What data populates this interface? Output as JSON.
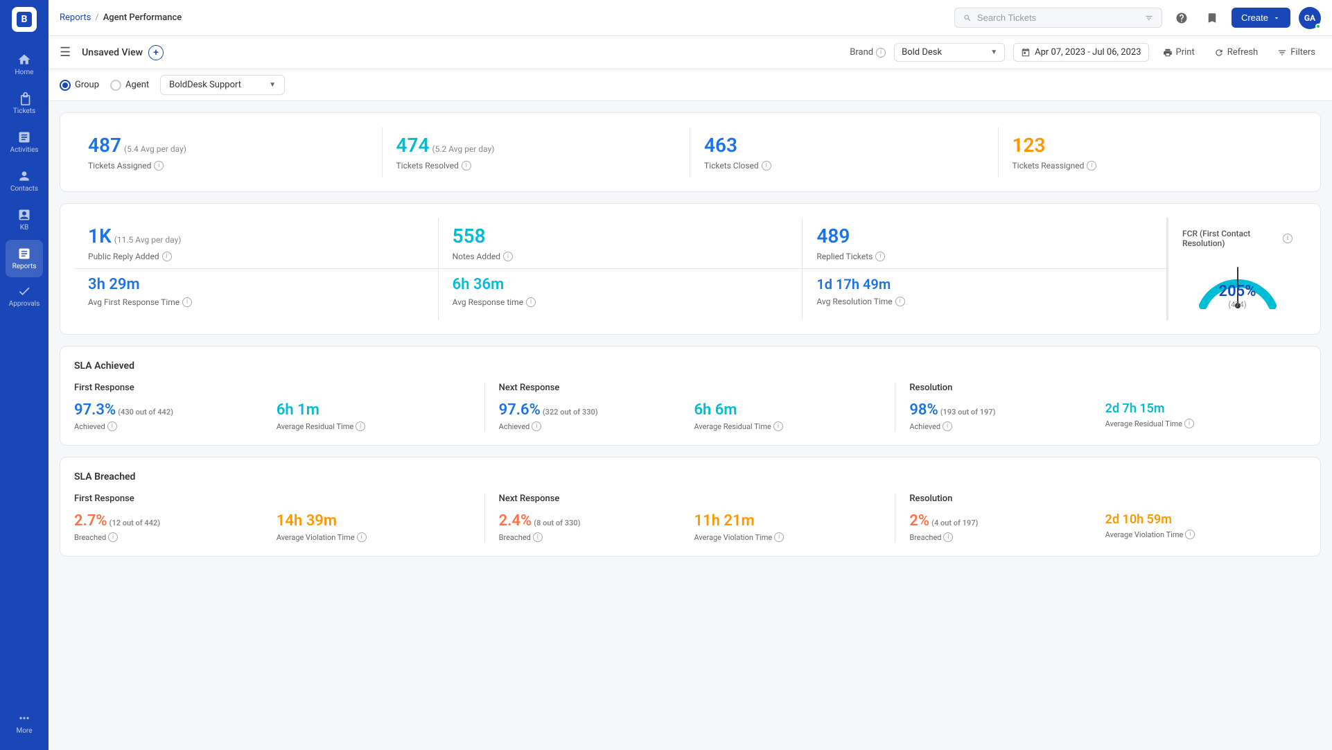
{
  "sidebar": {
    "logo_text": "B",
    "items": [
      {
        "id": "home",
        "label": "Home",
        "icon": "home"
      },
      {
        "id": "tickets",
        "label": "Tickets",
        "icon": "tickets"
      },
      {
        "id": "activities",
        "label": "Activities",
        "icon": "activities"
      },
      {
        "id": "contacts",
        "label": "Contacts",
        "icon": "contacts"
      },
      {
        "id": "kb",
        "label": "KB",
        "icon": "kb"
      },
      {
        "id": "reports",
        "label": "Reports",
        "icon": "reports",
        "active": true
      },
      {
        "id": "approvals",
        "label": "Approvals",
        "icon": "approvals"
      },
      {
        "id": "more",
        "label": "More",
        "icon": "more"
      }
    ]
  },
  "topnav": {
    "breadcrumb_reports": "Reports",
    "breadcrumb_sep": "/",
    "breadcrumb_current": "Agent Performance",
    "search_placeholder": "Search Tickets",
    "create_label": "Create",
    "avatar_initials": "GA"
  },
  "subheader": {
    "view_label": "Unsaved View",
    "brand_label": "Brand",
    "brand_value": "Bold Desk",
    "date_range": "Apr 07, 2023 - Jul 06, 2023",
    "print_label": "Print",
    "refresh_label": "Refresh",
    "filters_label": "Filters"
  },
  "toolbar": {
    "group_label": "Group",
    "agent_label": "Agent",
    "group_select_value": "BoldDesk Support"
  },
  "stats_row1": [
    {
      "value": "487",
      "avg": "(5.4 Avg per day)",
      "label": "Tickets Assigned",
      "color": "stat-blue"
    },
    {
      "value": "474",
      "avg": "(5.2 Avg per day)",
      "label": "Tickets Resolved",
      "color": "stat-teal"
    },
    {
      "value": "463",
      "avg": "",
      "label": "Tickets Closed",
      "color": "stat-blue"
    },
    {
      "value": "123",
      "avg": "",
      "label": "Tickets Reassigned",
      "color": "stat-orange"
    }
  ],
  "stats_row2": [
    {
      "value": "1K",
      "avg": "(11.5 Avg per day)",
      "label": "Public Reply Added",
      "color": "stat-blue"
    },
    {
      "value": "558",
      "avg": "",
      "label": "Notes Added",
      "color": "stat-teal"
    },
    {
      "value": "489",
      "avg": "",
      "label": "Replied Tickets",
      "color": "stat-blue"
    },
    {
      "value": "3h 29m",
      "avg": "",
      "label": "Avg First Response Time",
      "color": "stat-blue"
    },
    {
      "value": "6h 36m",
      "avg": "",
      "label": "Avg Response time",
      "color": "stat-teal"
    },
    {
      "value": "1d 17h 49m",
      "avg": "",
      "label": "Avg Resolution Time",
      "color": "stat-blue"
    }
  ],
  "fcr": {
    "title": "FCR (First Contact Resolution)",
    "percent": "205%",
    "sub": "(474)"
  },
  "sla_achieved": {
    "title": "SLA Achieved",
    "columns": [
      {
        "title": "First Response",
        "achieved_pct": "97.3%",
        "achieved_sub": "(430 out of 442)",
        "achieved_label": "Achieved",
        "residual_value": "6h 1m",
        "residual_label": "Average Residual Time"
      },
      {
        "title": "Next Response",
        "achieved_pct": "97.6%",
        "achieved_sub": "(322 out of 330)",
        "achieved_label": "Achieved",
        "residual_value": "6h 6m",
        "residual_label": "Average Residual Time"
      },
      {
        "title": "Resolution",
        "achieved_pct": "98%",
        "achieved_sub": "(193 out of 197)",
        "achieved_label": "Achieved",
        "residual_value": "2d 7h 15m",
        "residual_label": "Average Residual Time"
      }
    ]
  },
  "sla_breached": {
    "title": "SLA Breached",
    "columns": [
      {
        "title": "First Response",
        "breached_pct": "2.7%",
        "breached_sub": "(12 out of 442)",
        "breached_label": "Breached",
        "violation_value": "14h 39m",
        "violation_label": "Average Violation Time"
      },
      {
        "title": "Next Response",
        "breached_pct": "2.4%",
        "breached_sub": "(8 out of 330)",
        "breached_label": "Breached",
        "violation_value": "11h 21m",
        "violation_label": "Average Violation Time"
      },
      {
        "title": "Resolution",
        "breached_pct": "2%",
        "breached_sub": "(4 out of 197)",
        "breached_label": "Breached",
        "violation_value": "2d 10h 59m",
        "violation_label": "Average Violation Time"
      }
    ]
  }
}
